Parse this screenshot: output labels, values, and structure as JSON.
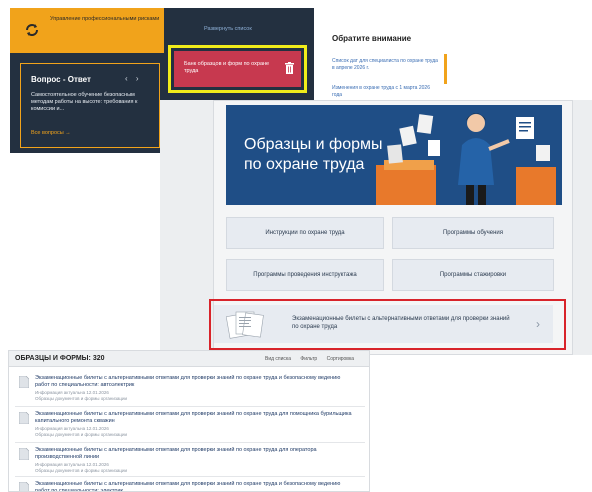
{
  "left_panel": {
    "risk_tile": "Управление профессиональными рисками",
    "qa_title": "Вопрос - Ответ",
    "qa_arrows": "‹ ›",
    "qa_text": "Самостоятельное обучение безопасным методам работы на высоте: требования к комиссии и...",
    "qa_all": "Все вопросы →"
  },
  "mid_panel": {
    "expand_link": "Развернуть список",
    "bank_button": "Банк образцов и форм по охране труда"
  },
  "attention": {
    "title": "Обратите внимание",
    "item_1": "Список дат для специалиста по охране труда в апреле 2026 г.",
    "item_2": "Изменения в охране труда с 1 марта 2026 года"
  },
  "main": {
    "hero_title": "Образцы и формы по охране труда",
    "tiles": [
      "Инструкции по охране труда",
      "Программы обучения",
      "Программы проведения инструктажа",
      "Программы стажировки"
    ],
    "exam_tile": "Экзаменационные билеты с альтернативными ответами для проверки знаний по охране труда"
  },
  "list": {
    "title": "ОБРАЗЦЫ И ФОРМЫ: 320",
    "tools": [
      "Вид списка",
      "Фильтр",
      "Сортировка"
    ],
    "items": [
      {
        "title": "Экзаменационные билеты с альтернативными ответами для проверки знаний по охране труда и безопасному ведению работ по специальности: автоэлектрик",
        "meta_1": "Информация актуальна 12.01.2026",
        "meta_2": "Образцы документов и формы организации"
      },
      {
        "title": "Экзаменационные билеты с альтернативными ответами для проверки знаний по охране труда для помощника бурильщика капитального ремонта скважин",
        "meta_1": "Информация актуальна 12.01.2026",
        "meta_2": "Образцы документов и формы организации"
      },
      {
        "title": "Экзаменационные билеты с альтернативными ответами для проверки знаний по охране труда для оператора производственной линии",
        "meta_1": "Информация актуальна 12.01.2026",
        "meta_2": "Образцы документов и формы организации"
      },
      {
        "title": "Экзаменационные билеты с альтернативными ответами для проверки знаний по охране труда и безопасному ведению работ по специальности: электрик",
        "meta_1": "",
        "meta_2": ""
      }
    ]
  },
  "colors": {
    "dark": "#233040",
    "orange": "#f1a31b",
    "highlight_yellow": "#f0ec1a",
    "highlight_red": "#d8232a",
    "hero_blue": "#1f4e86"
  }
}
